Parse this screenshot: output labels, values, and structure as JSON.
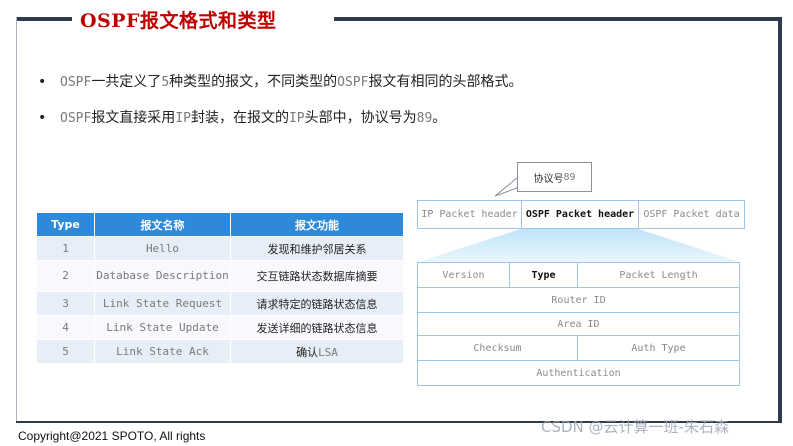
{
  "title": "OSPF报文格式和类型",
  "bullets": [
    {
      "pre": "",
      "mono1": "OSPF",
      "mid1": "一共定义了",
      "mono2": "5",
      "mid2": "种类型的报文，不同类型的",
      "mono3": "OSPF",
      "post": "报文有相同的头部格式。"
    },
    {
      "pre": "",
      "mono1": "OSPF",
      "mid1": "报文直接采用",
      "mono2": "IP",
      "mid2": "封装，在报文的",
      "mono3": "IP",
      "post": "头部中，协议号为",
      "mono4": "89",
      "end": "。"
    }
  ],
  "table": {
    "headers": [
      "Type",
      "报文名称",
      "报文功能"
    ],
    "rows": [
      {
        "type": "1",
        "name": "Hello",
        "func": "发现和维护邻居关系"
      },
      {
        "type": "2",
        "name": "Database Description",
        "func": "交互链路状态数据库摘要"
      },
      {
        "type": "3",
        "name": "Link State Request",
        "func": "请求特定的链路状态信息"
      },
      {
        "type": "4",
        "name": "Link State Update",
        "func": "发送详细的链路状态信息"
      },
      {
        "type": "5",
        "name": "Link State Ack",
        "func_pre": "确认",
        "func_mono": "LSA"
      }
    ]
  },
  "callout": {
    "label": "协议号",
    "num": "89"
  },
  "packet": {
    "ip_header": "IP Packet header",
    "ospf_header": "OSPF Packet header",
    "ospf_data": "OSPF Packet data"
  },
  "ospf_header_fields": {
    "version": "Version",
    "type": "Type",
    "packet_length": "Packet Length",
    "router_id": "Router ID",
    "area_id": "Area ID",
    "checksum": "Checksum",
    "auth_type": "Auth Type",
    "authentication": "Authentication"
  },
  "copyright": "Copyright@2021 SPOTO, All rights",
  "watermark": "CSDN @云计算一班-朱石森",
  "colors": {
    "title": "#c00000",
    "table_header": "#2e8ad8",
    "frame": "#2f3b4c",
    "diagram_border": "#9fc6e8"
  }
}
